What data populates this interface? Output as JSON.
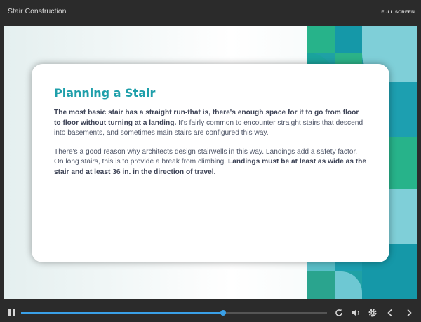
{
  "window": {
    "title": "Stair Construction",
    "fullscreen_label": "FULL SCREEN"
  },
  "slide": {
    "heading": "Planning a Stair",
    "paragraph1": {
      "bold": "The most basic stair has a straight run-that is, there's enough space for it to go from floor to floor without turning at a landing.",
      "normal": " It's fairly common to encounter straight stairs that descend into basements, and sometimes main stairs are configured this way."
    },
    "paragraph2": {
      "normal": "There's a good reason why architects design stairwells in this way. Landings add a safety factor. On long stairs, this is to provide a break from climbing. ",
      "bold": "Landings must be at least as wide as the stair and at least 36 in. in the direction of travel."
    }
  },
  "player": {
    "progress": 0.66,
    "icons": [
      "pause-icon",
      "replay-icon",
      "volume-icon",
      "settings-icon",
      "previous-icon",
      "next-icon"
    ]
  },
  "colors": {
    "accent": "#1e9faa",
    "progress": "#3aa0e8",
    "teal": "#1fa1a5",
    "green": "#2bb288"
  }
}
